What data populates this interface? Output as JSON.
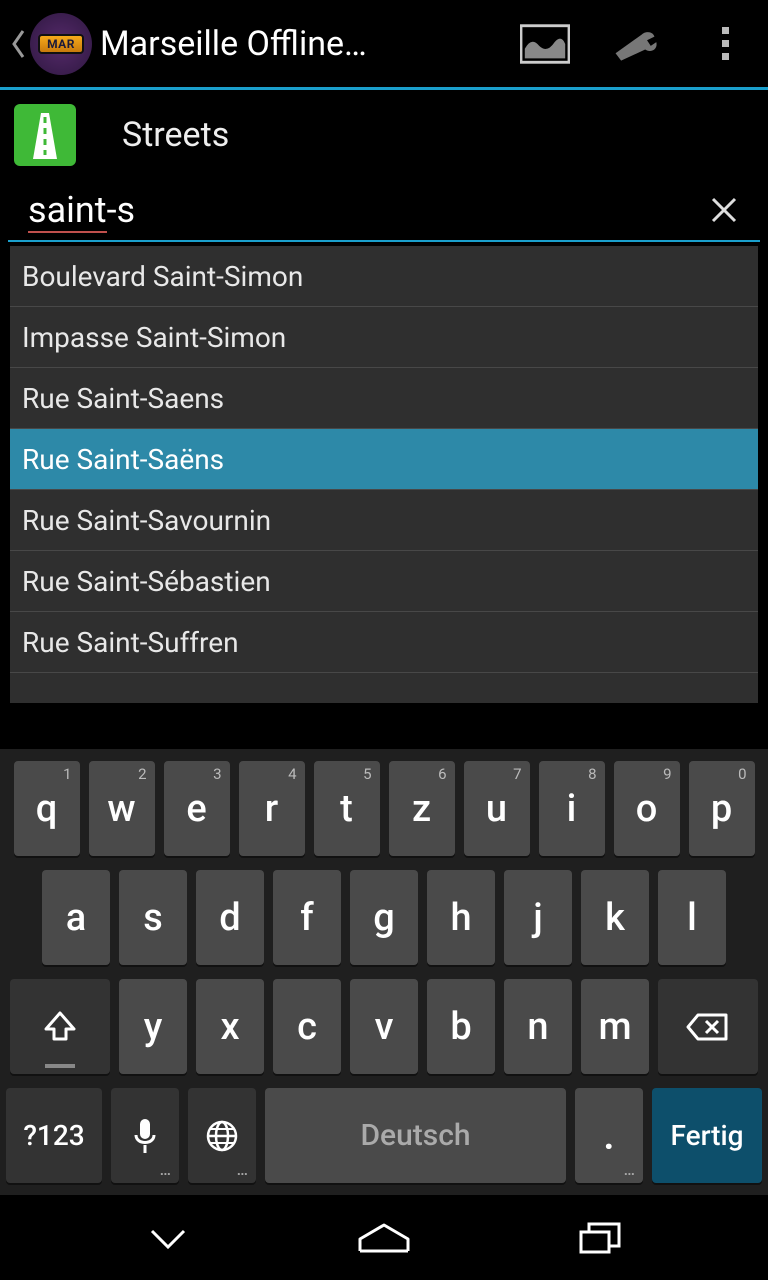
{
  "header": {
    "app_title": "Marseille Offline…",
    "logo_text": "MAR"
  },
  "section": {
    "label": "Streets"
  },
  "search": {
    "value_underlined": "saint",
    "value_rest": "-s"
  },
  "results": [
    {
      "label": "Boulevard Saint-Simon",
      "selected": false
    },
    {
      "label": "Impasse Saint-Simon",
      "selected": false
    },
    {
      "label": "Rue Saint-Saens",
      "selected": false
    },
    {
      "label": "Rue Saint-Saëns",
      "selected": true
    },
    {
      "label": "Rue Saint-Savournin",
      "selected": false
    },
    {
      "label": "Rue Saint-Sébastien",
      "selected": false
    },
    {
      "label": "Rue Saint-Suffren",
      "selected": false
    }
  ],
  "keyboard": {
    "row1": [
      {
        "main": "q",
        "sup": "1"
      },
      {
        "main": "w",
        "sup": "2"
      },
      {
        "main": "e",
        "sup": "3"
      },
      {
        "main": "r",
        "sup": "4"
      },
      {
        "main": "t",
        "sup": "5"
      },
      {
        "main": "z",
        "sup": "6"
      },
      {
        "main": "u",
        "sup": "7"
      },
      {
        "main": "i",
        "sup": "8"
      },
      {
        "main": "o",
        "sup": "9"
      },
      {
        "main": "p",
        "sup": "0"
      }
    ],
    "row2": [
      "a",
      "s",
      "d",
      "f",
      "g",
      "h",
      "j",
      "k",
      "l"
    ],
    "row3": [
      "y",
      "x",
      "c",
      "v",
      "b",
      "n",
      "m"
    ],
    "symbols_label": "?123",
    "space_label": "Deutsch",
    "period_label": ".",
    "done_label": "Fertig"
  }
}
